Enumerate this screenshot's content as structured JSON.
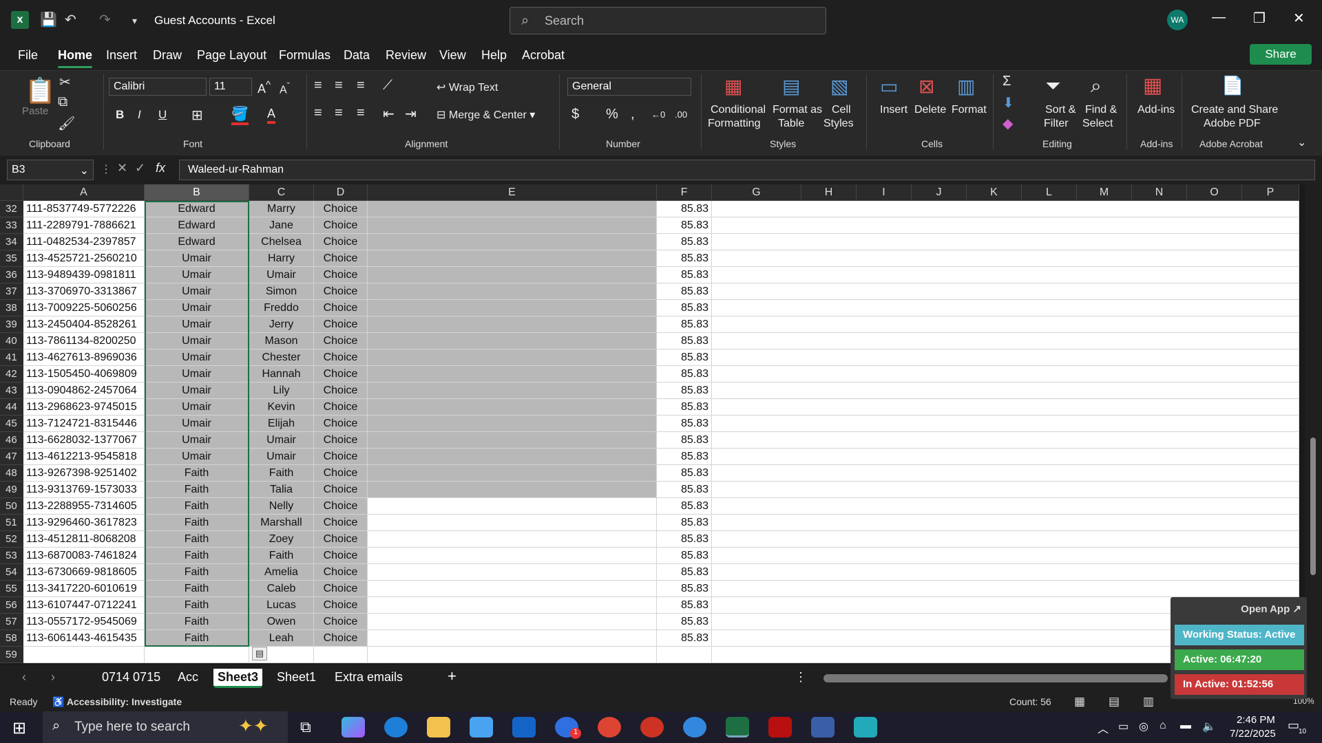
{
  "app": {
    "title": "Guest Accounts  -  Excel",
    "search_placeholder": "Search",
    "avatar": "WA",
    "share_label": "Share"
  },
  "menu": [
    "File",
    "Home",
    "Insert",
    "Draw",
    "Page Layout",
    "Formulas",
    "Data",
    "Review",
    "View",
    "Help",
    "Acrobat"
  ],
  "ribbon": {
    "clipboard": {
      "paste": "Paste",
      "label": "Clipboard"
    },
    "font": {
      "name": "Calibri",
      "size": "11",
      "label": "Font"
    },
    "alignment": {
      "wrap": "Wrap Text",
      "merge": "Merge & Center",
      "label": "Alignment"
    },
    "number": {
      "format": "General",
      "label": "Number"
    },
    "styles": {
      "conditional": "Conditional",
      "conditional2": "Formatting",
      "format_table": "Format as",
      "format_table2": "Table",
      "cell_styles": "Cell",
      "cell_styles2": "Styles",
      "label": "Styles"
    },
    "cells": {
      "insert": "Insert",
      "delete": "Delete",
      "format": "Format",
      "label": "Cells"
    },
    "editing": {
      "sort": "Sort &",
      "sort2": "Filter",
      "find": "Find &",
      "find2": "Select",
      "label": "Editing"
    },
    "addins": {
      "btn": "Add-ins",
      "label": "Add-ins"
    },
    "acrobat": {
      "btn": "Create and Share",
      "btn2": "Adobe PDF",
      "label": "Adobe Acrobat"
    }
  },
  "formula_bar": {
    "name_box": "B3",
    "fx": "fx",
    "value": "Waleed-ur-Rahman"
  },
  "columns": [
    "A",
    "B",
    "C",
    "D",
    "E",
    "F",
    "G",
    "H",
    "I",
    "J",
    "K",
    "L",
    "M",
    "N",
    "O",
    "P"
  ],
  "rows": [
    {
      "n": "32",
      "a": "111-8537749-5772226",
      "b": "Edward",
      "c": "Marry",
      "d": "Choice",
      "f": "85.83"
    },
    {
      "n": "33",
      "a": "111-2289791-7886621",
      "b": "Edward",
      "c": "Jane",
      "d": "Choice",
      "f": "85.83"
    },
    {
      "n": "34",
      "a": "111-0482534-2397857",
      "b": "Edward",
      "c": "Chelsea",
      "d": "Choice",
      "f": "85.83"
    },
    {
      "n": "35",
      "a": "113-4525721-2560210",
      "b": "Umair",
      "c": "Harry",
      "d": "Choice",
      "f": "85.83"
    },
    {
      "n": "36",
      "a": "113-9489439-0981811",
      "b": "Umair",
      "c": "Umair",
      "d": "Choice",
      "f": "85.83"
    },
    {
      "n": "37",
      "a": "113-3706970-3313867",
      "b": "Umair",
      "c": "Simon",
      "d": "Choice",
      "f": "85.83"
    },
    {
      "n": "38",
      "a": "113-7009225-5060256",
      "b": "Umair",
      "c": "Freddo",
      "d": "Choice",
      "f": "85.83"
    },
    {
      "n": "39",
      "a": "113-2450404-8528261",
      "b": "Umair",
      "c": "Jerry",
      "d": "Choice",
      "f": "85.83"
    },
    {
      "n": "40",
      "a": "113-7861134-8200250",
      "b": "Umair",
      "c": "Mason",
      "d": "Choice",
      "f": "85.83"
    },
    {
      "n": "41",
      "a": "113-4627613-8969036",
      "b": "Umair",
      "c": "Chester",
      "d": "Choice",
      "f": "85.83"
    },
    {
      "n": "42",
      "a": "113-1505450-4069809",
      "b": "Umair",
      "c": "Hannah",
      "d": "Choice",
      "f": "85.83"
    },
    {
      "n": "43",
      "a": "113-0904862-2457064",
      "b": "Umair",
      "c": "Lily",
      "d": "Choice",
      "f": "85.83"
    },
    {
      "n": "44",
      "a": "113-2968623-9745015",
      "b": "Umair",
      "c": "Kevin",
      "d": "Choice",
      "f": "85.83"
    },
    {
      "n": "45",
      "a": "113-7124721-8315446",
      "b": "Umair",
      "c": "Elijah",
      "d": "Choice",
      "f": "85.83"
    },
    {
      "n": "46",
      "a": "113-6628032-1377067",
      "b": "Umair",
      "c": "Umair",
      "d": "Choice",
      "f": "85.83"
    },
    {
      "n": "47",
      "a": "113-4612213-9545818",
      "b": "Umair",
      "c": "Umair",
      "d": "Choice",
      "f": "85.83"
    },
    {
      "n": "48",
      "a": "113-9267398-9251402",
      "b": "Faith",
      "c": "Faith",
      "d": "Choice",
      "f": "85.83"
    },
    {
      "n": "49",
      "a": "113-9313769-1573033",
      "b": "Faith",
      "c": "Talia",
      "d": "Choice",
      "f": "85.83"
    },
    {
      "n": "50",
      "a": "113-2288955-7314605",
      "b": "Faith",
      "c": "Nelly",
      "d": "Choice",
      "f": "85.83"
    },
    {
      "n": "51",
      "a": "113-9296460-3617823",
      "b": "Faith",
      "c": "Marshall",
      "d": "Choice",
      "f": "85.83"
    },
    {
      "n": "52",
      "a": "113-4512811-8068208",
      "b": "Faith",
      "c": "Zoey",
      "d": "Choice",
      "f": "85.83"
    },
    {
      "n": "53",
      "a": "113-6870083-7461824",
      "b": "Faith",
      "c": "Faith",
      "d": "Choice",
      "f": "85.83"
    },
    {
      "n": "54",
      "a": "113-6730669-9818605",
      "b": "Faith",
      "c": "Amelia",
      "d": "Choice",
      "f": "85.83"
    },
    {
      "n": "55",
      "a": "113-3417220-6010619",
      "b": "Faith",
      "c": "Caleb",
      "d": "Choice",
      "f": "85.83"
    },
    {
      "n": "56",
      "a": "113-6107447-0712241",
      "b": "Faith",
      "c": "Lucas",
      "d": "Choice",
      "f": "85.83"
    },
    {
      "n": "57",
      "a": "113-0557172-9545069",
      "b": "Faith",
      "c": "Owen",
      "d": "Choice",
      "f": "85.83"
    },
    {
      "n": "58",
      "a": "113-6061443-4615435",
      "b": "Faith",
      "c": "Leah",
      "d": "Choice",
      "f": "85.83"
    },
    {
      "n": "59",
      "a": "",
      "b": "",
      "c": "",
      "d": "",
      "f": ""
    }
  ],
  "sheets": [
    "0714 0715",
    "Acc",
    "Sheet3",
    "Sheet1",
    "Extra emails"
  ],
  "active_sheet": "Sheet3",
  "status": {
    "ready": "Ready",
    "accessibility": "Accessibility: Investigate",
    "count": "Count: 56",
    "zoom": "100%"
  },
  "widget": {
    "open_app": "Open App ↗",
    "working": "Working Status: Active",
    "active": "Active: 06:47:20",
    "inactive": "In Active: 01:52:56"
  },
  "taskbar": {
    "search_placeholder": "Type here to search",
    "time": "2:46 PM",
    "date": "7/22/2025",
    "badge": "1",
    "notif": "10"
  }
}
